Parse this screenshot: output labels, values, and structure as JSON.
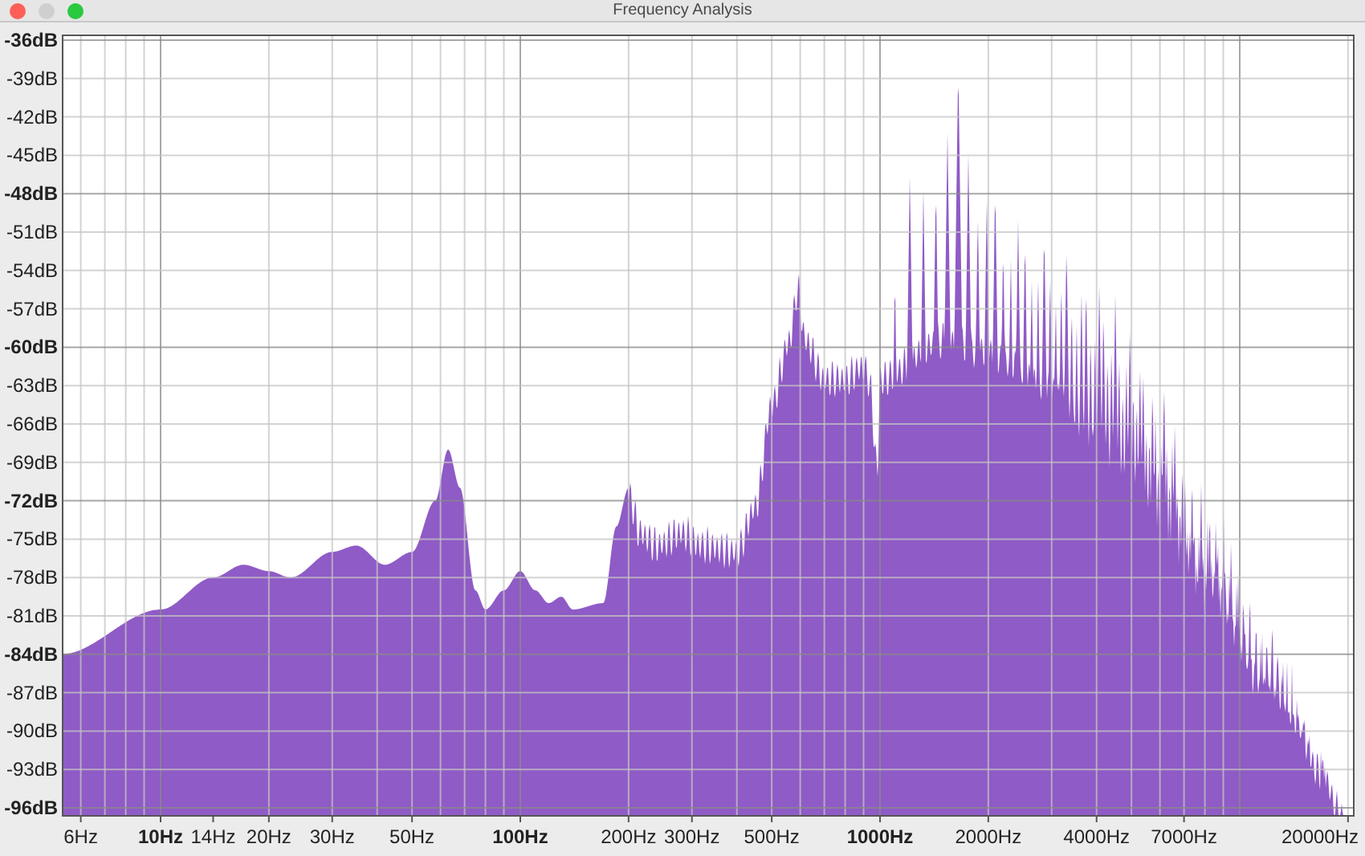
{
  "window": {
    "title": "Frequency Analysis"
  },
  "y_axis": {
    "ticks": [
      {
        "label": "-36dB",
        "major": true
      },
      {
        "label": "-39dB",
        "major": false
      },
      {
        "label": "-42dB",
        "major": false
      },
      {
        "label": "-45dB",
        "major": false
      },
      {
        "label": "-48dB",
        "major": true
      },
      {
        "label": "-51dB",
        "major": false
      },
      {
        "label": "-54dB",
        "major": false
      },
      {
        "label": "-57dB",
        "major": false
      },
      {
        "label": "-60dB",
        "major": true
      },
      {
        "label": "-63dB",
        "major": false
      },
      {
        "label": "-66dB",
        "major": false
      },
      {
        "label": "-69dB",
        "major": false
      },
      {
        "label": "-72dB",
        "major": true
      },
      {
        "label": "-75dB",
        "major": false
      },
      {
        "label": "-78dB",
        "major": false
      },
      {
        "label": "-81dB",
        "major": false
      },
      {
        "label": "-84dB",
        "major": true
      },
      {
        "label": "-87dB",
        "major": false
      },
      {
        "label": "-90dB",
        "major": false
      },
      {
        "label": "-93dB",
        "major": false
      },
      {
        "label": "-96dB",
        "major": true
      }
    ]
  },
  "x_axis": {
    "ticks": [
      {
        "label": "6Hz",
        "major": false
      },
      {
        "label": "10Hz",
        "major": true
      },
      {
        "label": "14Hz",
        "major": false
      },
      {
        "label": "20Hz",
        "major": false
      },
      {
        "label": "30Hz",
        "major": false
      },
      {
        "label": "50Hz",
        "major": false
      },
      {
        "label": "100Hz",
        "major": true
      },
      {
        "label": "200Hz",
        "major": false
      },
      {
        "label": "300Hz",
        "major": false
      },
      {
        "label": "500Hz",
        "major": false
      },
      {
        "label": "1000Hz",
        "major": true
      },
      {
        "label": "2000Hz",
        "major": false
      },
      {
        "label": "4000Hz",
        "major": false
      },
      {
        "label": "7000Hz",
        "major": false
      },
      {
        "label": "20000Hz",
        "major": false
      }
    ]
  }
}
